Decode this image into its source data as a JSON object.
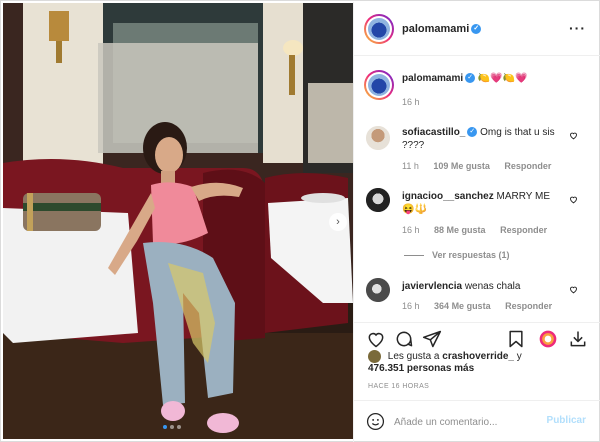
{
  "post": {
    "author": "palomamami",
    "caption_emoji": "🍋💗🍋💗",
    "caption_time": "16 h",
    "verified_mark": "✓"
  },
  "comments": [
    {
      "user": "sofiacastillo_",
      "verified": true,
      "text": "Omg is that u sis ????",
      "time": "11 h",
      "likes": "109 Me gusta",
      "reply": "Responder"
    },
    {
      "user": "ignacioo__sanchez",
      "verified": false,
      "text": "MARRY ME",
      "emoji": "😝🔱",
      "time": "16 h",
      "likes": "88 Me gusta",
      "reply": "Responder",
      "view_replies": "Ver respuestas (1)"
    },
    {
      "user": "javiervlencia",
      "verified": false,
      "text": "wenas chala",
      "time": "16 h",
      "likes": "364 Me gusta",
      "reply": "Responder"
    }
  ],
  "likes": {
    "prefix": "Les gusta a",
    "user": "crashoverride_",
    "connector": "y",
    "count": "476.351 personas más"
  },
  "timestamp": "HACE 16 HORAS",
  "compose": {
    "placeholder": "Añade un comentario...",
    "publish": "Publicar"
  },
  "icons": {
    "more": "more-options-icon",
    "like": "heart-icon",
    "comment": "comment-icon",
    "share": "send-icon",
    "save": "bookmark-icon",
    "next": "chevron-right-icon",
    "emoji": "smiley-icon"
  },
  "carousel": {
    "current": 1,
    "total": 3
  },
  "colors": {
    "accent": "#3897f0",
    "publish_disabled": "#b2dffc",
    "muted": "#8e8e8e",
    "text": "#262626"
  }
}
